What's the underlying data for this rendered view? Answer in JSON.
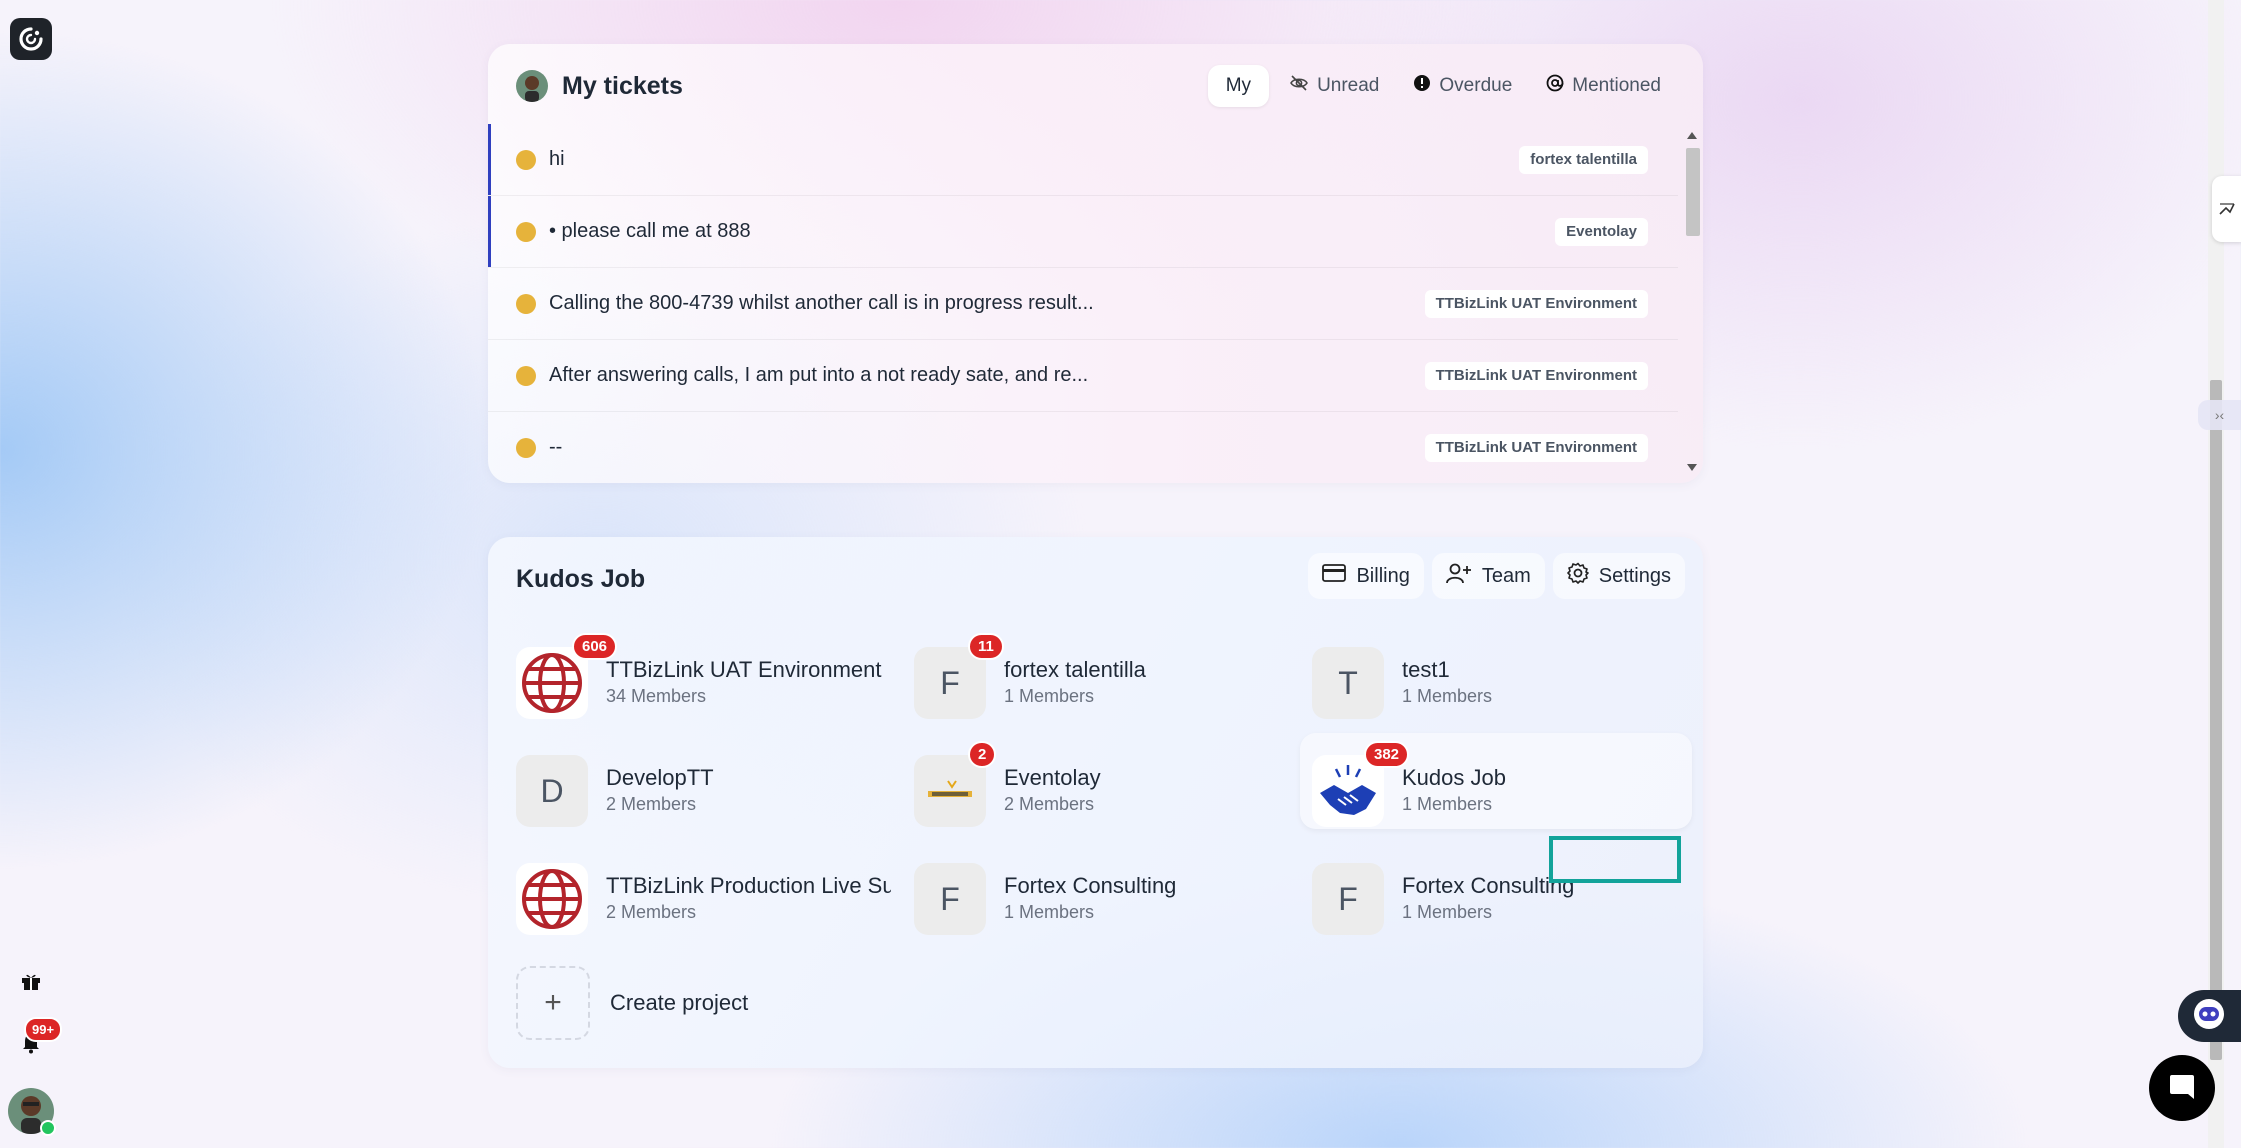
{
  "rail": {
    "logo_icon": "app-logo-icon",
    "gift_icon": "gift-icon",
    "bell_icon": "bell-icon",
    "notifications_badge": "99+"
  },
  "tickets": {
    "title": "My tickets",
    "filters": [
      {
        "label": "My",
        "icon": ""
      },
      {
        "label": "Unread",
        "icon": "eye-off-icon"
      },
      {
        "label": "Overdue",
        "icon": "alert-circle-icon"
      },
      {
        "label": "Mentioned",
        "icon": "at-icon"
      }
    ],
    "rows": [
      {
        "text": "hi",
        "tag": "fortex talentilla",
        "unread": true
      },
      {
        "text": "• please call me at 888",
        "tag": "Eventolay",
        "unread": true
      },
      {
        "text": "Calling the 800-4739 whilst another call is in progress result...",
        "tag": "TTBizLink UAT Environment",
        "unread": false
      },
      {
        "text": "After answering calls, I am put into a not ready sate, and re...",
        "tag": "TTBizLink UAT Environment",
        "unread": false
      },
      {
        "text": "--",
        "tag": "TTBizLink UAT Environment",
        "unread": false
      }
    ]
  },
  "workspace": {
    "title": "Kudos Job",
    "actions": {
      "billing": "Billing",
      "team": "Team",
      "settings": "Settings"
    },
    "projects": [
      {
        "name": "TTBizLink UAT Environment",
        "members": "34 Members",
        "badge": "606",
        "avatar": "globe-logo"
      },
      {
        "name": "fortex talentilla",
        "members": "1 Members",
        "badge": "11",
        "avatar": "F"
      },
      {
        "name": "test1",
        "members": "1 Members",
        "badge": "",
        "avatar": "T"
      },
      {
        "name": "DevelopTT",
        "members": "2 Members",
        "badge": "",
        "avatar": "D"
      },
      {
        "name": "Eventolay",
        "members": "2 Members",
        "badge": "2",
        "avatar": "eventolay-logo"
      },
      {
        "name": "Kudos Job",
        "members": "1 Members",
        "badge": "382",
        "avatar": "handshake-logo"
      },
      {
        "name": "TTBizLink Production Live Su",
        "members": "2 Members",
        "badge": "",
        "avatar": "globe-logo"
      },
      {
        "name": "Fortex Consulting",
        "members": "1 Members",
        "badge": "",
        "avatar": "F"
      },
      {
        "name": "Fortex Consulting",
        "members": "1 Members",
        "badge": "",
        "avatar": "F"
      }
    ],
    "create_label": "Create project",
    "create_symbol": "+"
  },
  "colors": {
    "ticket_dot": "#e6b33b",
    "unread_bar": "#2f3fbf",
    "badge": "#dc2626",
    "focus_highlight": "#12a39a"
  }
}
